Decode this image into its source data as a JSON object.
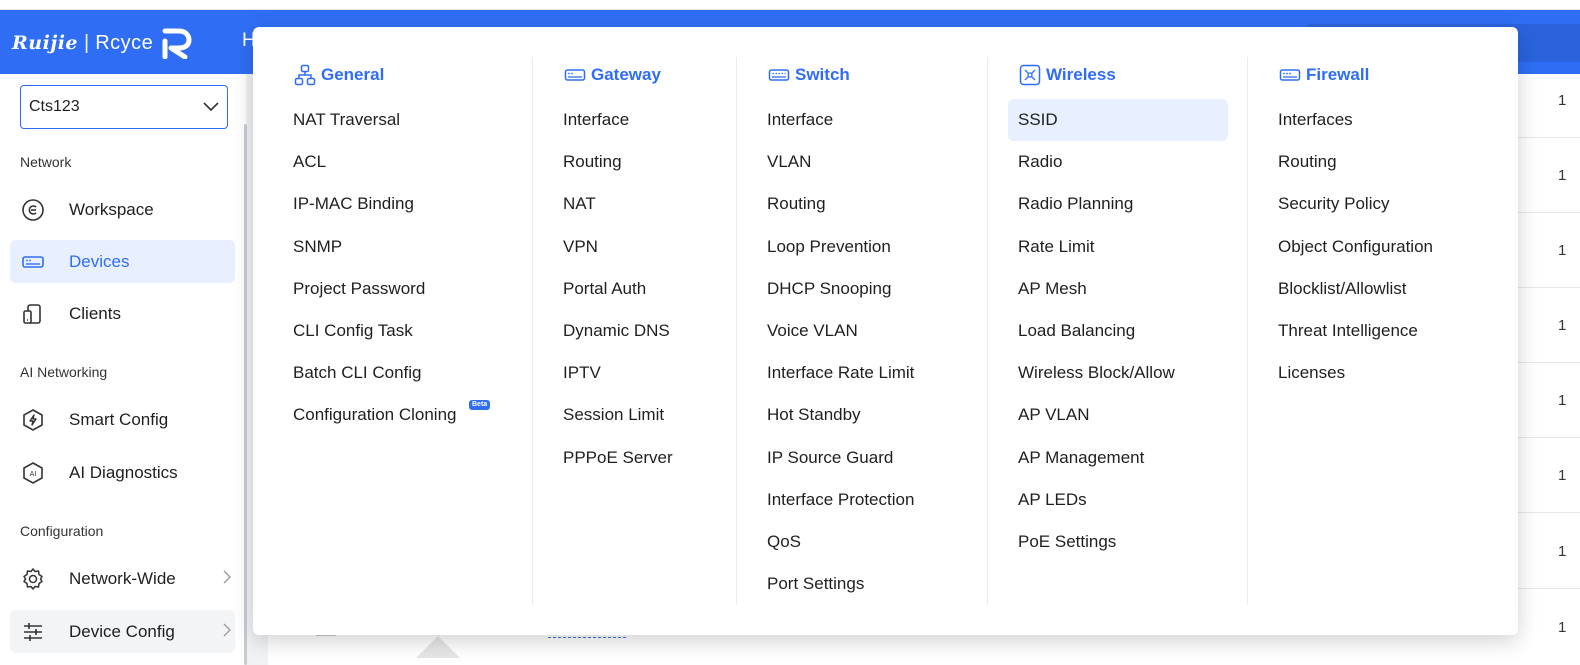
{
  "header": {
    "brand": "Ruijie",
    "product": "Rcyce",
    "tab_partial": "H"
  },
  "sidebar": {
    "project_value": "Cts123",
    "sections": [
      {
        "label": "Network",
        "items": [
          {
            "label": "Workspace",
            "icon": "workspace-icon"
          },
          {
            "label": "Devices",
            "icon": "devices-icon",
            "active": true
          },
          {
            "label": "Clients",
            "icon": "clients-icon"
          }
        ]
      },
      {
        "label": "AI Networking",
        "items": [
          {
            "label": "Smart Config",
            "icon": "smart-config-icon"
          },
          {
            "label": "AI Diagnostics",
            "icon": "ai-diagnostics-icon"
          }
        ]
      },
      {
        "label": "Configuration",
        "items": [
          {
            "label": "Network-Wide",
            "icon": "gear-icon",
            "has_submenu": true
          },
          {
            "label": "Device Config",
            "icon": "sliders-icon",
            "has_submenu": true
          }
        ]
      }
    ]
  },
  "background": {
    "row_numbers": [
      "1",
      "1",
      "1",
      "1",
      "1",
      "1",
      "1",
      "1"
    ]
  },
  "menu": {
    "columns": [
      {
        "title": "General",
        "icon": "topology-icon",
        "items": [
          "NAT Traversal",
          "ACL",
          "IP-MAC Binding",
          "SNMP",
          "Project Password",
          "CLI Config Task",
          "Batch CLI Config",
          "Configuration Cloning"
        ],
        "badge": {
          "item_index": 7,
          "text": "Beta"
        }
      },
      {
        "title": "Gateway",
        "icon": "gateway-icon",
        "items": [
          "Interface",
          "Routing",
          "NAT",
          "VPN",
          "Portal Auth",
          "Dynamic DNS",
          "IPTV",
          "Session Limit",
          "PPPoE Server"
        ]
      },
      {
        "title": "Switch",
        "icon": "switch-icon",
        "items": [
          "Interface",
          "VLAN",
          "Routing",
          "Loop Prevention",
          "DHCP Snooping",
          "Voice VLAN",
          "Interface Rate Limit",
          "Hot Standby",
          "IP Source Guard",
          "Interface Protection",
          "QoS",
          "Port Settings"
        ]
      },
      {
        "title": "Wireless",
        "icon": "wireless-ap-icon",
        "items": [
          "SSID",
          "Radio",
          "Radio Planning",
          "Rate Limit",
          "AP Mesh",
          "Load Balancing",
          "Wireless Block/Allow",
          "AP VLAN",
          "AP Management",
          "AP LEDs",
          "PoE Settings"
        ],
        "selected_index": 0
      },
      {
        "title": "Firewall",
        "icon": "firewall-icon",
        "items": [
          "Interfaces",
          "Routing",
          "Security Policy",
          "Object Configuration",
          "Blocklist/Allowlist",
          "Threat Intelligence",
          "Licenses"
        ]
      }
    ]
  },
  "colors": {
    "primary": "#2f6ef4",
    "active_bg": "#e8efff",
    "text": "#1f1f1f"
  }
}
